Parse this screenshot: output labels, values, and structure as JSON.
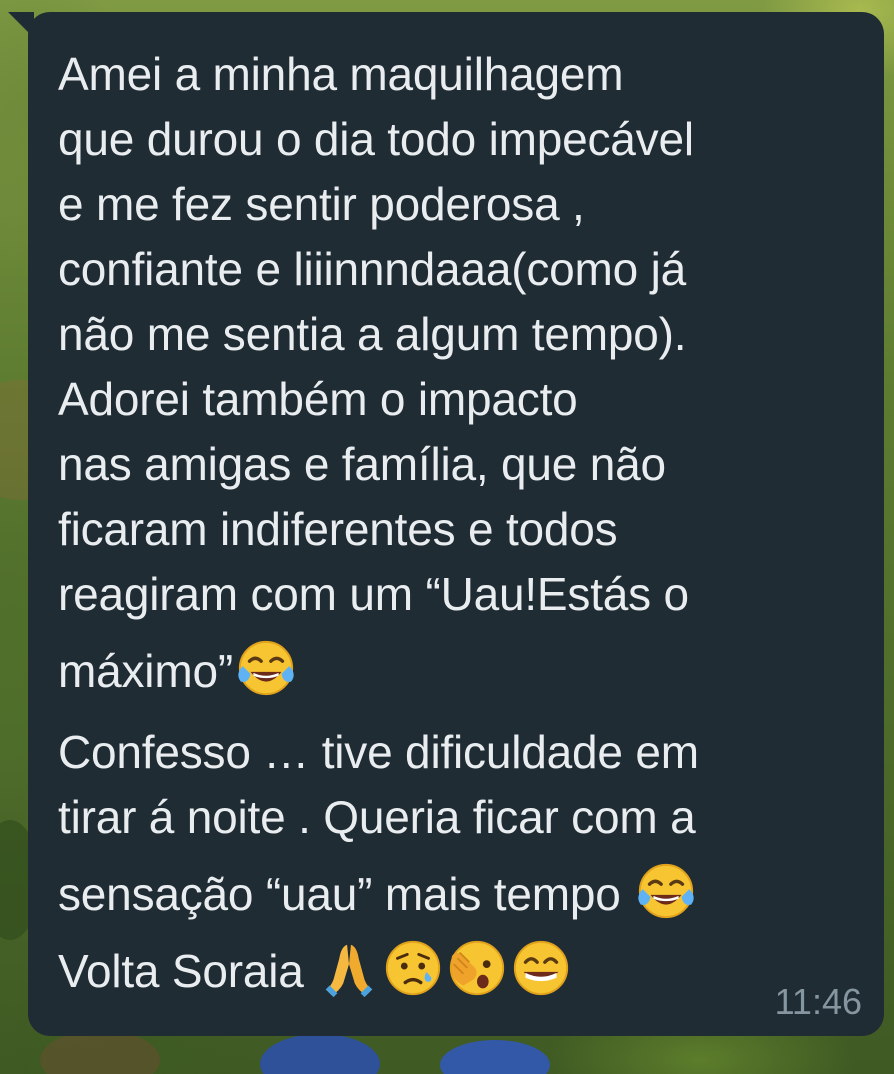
{
  "message": {
    "lines": [
      "Amei a minha maquilhagem",
      "que durou o dia todo impecável",
      "e me fez sentir poderosa ,",
      "confiante e liiinnndaaa(como já",
      "não me sentia a algum tempo).",
      "Adorei também o impacto",
      "nas amigas e família, que não",
      "ficaram indiferentes e todos",
      "reagiram com um “Uau!Estás o",
      "máximo”",
      "Confesso … tive dificuldade em",
      "tirar á noite . Queria ficar com a",
      "sensação “uau” mais tempo ",
      "Volta Soraia "
    ],
    "time": "11:46",
    "emojis": {
      "line_10": "tears-of-joy-emoji",
      "line_13": "tears-of-joy-emoji",
      "line_14": [
        "folded-hands-emoji",
        "sad-sweat-emoji",
        "face-with-hand-over-eye-emoji",
        "grinning-emoji"
      ]
    }
  },
  "colors": {
    "bubble": "#1f2c34",
    "text": "#e9edef",
    "timestamp": "#8696a0"
  }
}
